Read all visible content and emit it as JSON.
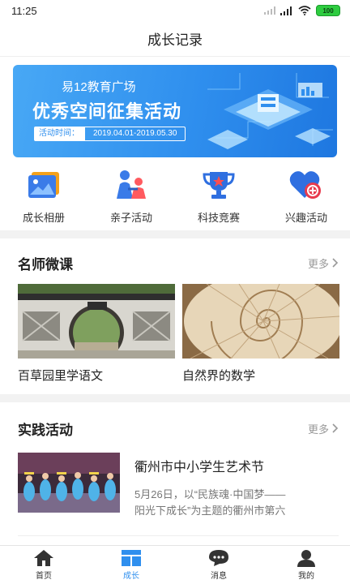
{
  "status_bar": {
    "time": "11:25",
    "battery": "100"
  },
  "header": {
    "title": "成长记录"
  },
  "banner": {
    "subtitle": "易12教育广场",
    "title": "优秀空间征集活动",
    "time_label": "活动时间：",
    "time_value": "2019.04.01-2019.05.30"
  },
  "quick_links": [
    {
      "label": "成长相册",
      "icon": "photo-album-icon",
      "color": "#3a7be8"
    },
    {
      "label": "亲子活动",
      "icon": "parent-child-icon",
      "color": "#ff5a5f"
    },
    {
      "label": "科技竞赛",
      "icon": "trophy-icon",
      "color": "#2f6fe0"
    },
    {
      "label": "兴趣活动",
      "icon": "heart-icon",
      "color": "#e83b4e"
    }
  ],
  "teacher_courses": {
    "title": "名师微课",
    "more_label": "更多",
    "items": [
      {
        "title": "百草园里学语文",
        "image": "garden-gate-image"
      },
      {
        "title": "自然界的数学",
        "image": "nautilus-shell-image"
      }
    ]
  },
  "practice_activities": {
    "title": "实践活动",
    "more_label": "更多",
    "items": [
      {
        "title": "衢州市中小学生艺术节",
        "desc_line1": "5月26日，以“民族魂·中国梦——",
        "desc_line2": "阳光下成长”为主题的衢州市第六",
        "image": "stage-performance-image"
      }
    ]
  },
  "tab_bar": {
    "active_color": "#2f8fee",
    "tabs": [
      {
        "label": "首页",
        "icon": "home-icon",
        "active": false
      },
      {
        "label": "成长",
        "icon": "growth-icon",
        "active": true
      },
      {
        "label": "消息",
        "icon": "message-icon",
        "active": false
      },
      {
        "label": "我的",
        "icon": "profile-icon",
        "active": false
      }
    ]
  }
}
